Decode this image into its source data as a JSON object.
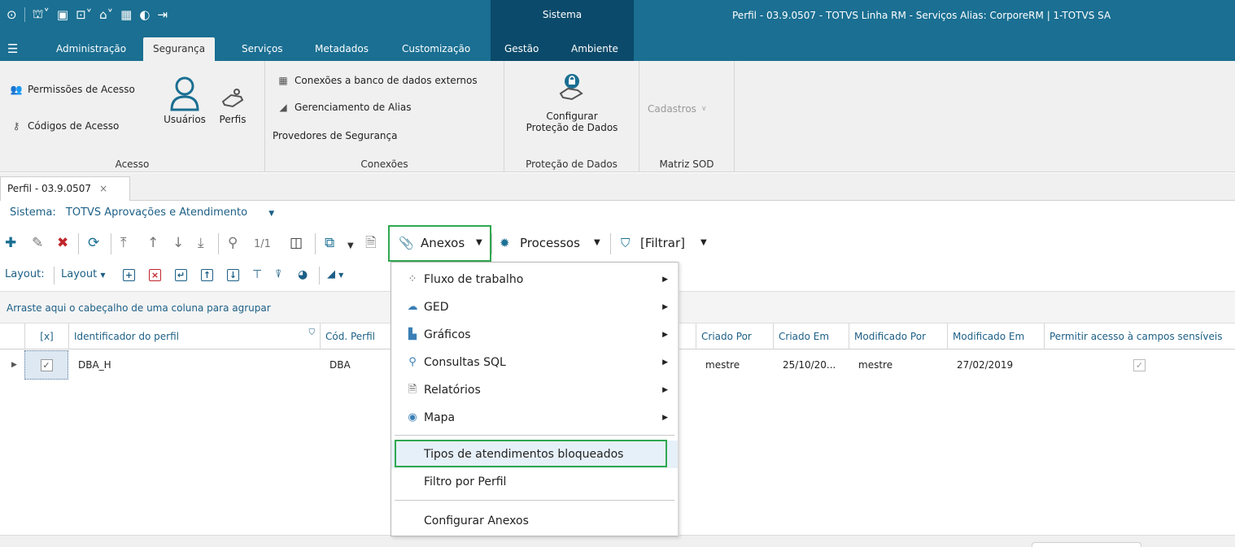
{
  "window": {
    "system_label": "Sistema",
    "title": "Perfil - 03.9.0507 - TOTVS Linha RM - Serviços  Alias: CorporeRM | 1-TOTVS SA"
  },
  "quick_access": [
    "system-menu-icon",
    "org-icon",
    "window-icon",
    "screen-icon",
    "home-icon",
    "calc-icon",
    "globe-icon",
    "exit-icon"
  ],
  "tabs": [
    {
      "label": "Administração"
    },
    {
      "label": "Segurança"
    },
    {
      "label": "Serviços"
    },
    {
      "label": "Metadados"
    },
    {
      "label": "Customização"
    },
    {
      "label": "Gestão"
    },
    {
      "label": "Ambiente"
    }
  ],
  "ribbon": {
    "acesso": {
      "permissoes": "Permissões de Acesso",
      "codigos": "Códigos de Acesso",
      "usuarios": "Usuários",
      "perfis": "Perfis",
      "label": "Acesso"
    },
    "conexoes": {
      "externos": "Conexões a banco de dados externos",
      "alias": "Gerenciamento de Alias",
      "provedores": "Provedores de Segurança",
      "label": "Conexões"
    },
    "protecao": {
      "configurar_line1": "Configurar",
      "configurar_line2": "Proteção de Dados",
      "label": "Proteção de Dados"
    },
    "matriz": {
      "cadastros": "Cadastros",
      "label": "Matriz SOD"
    }
  },
  "doc_tab": {
    "label": "Perfil - 03.9.0507",
    "close": "×"
  },
  "sistema": {
    "label": "Sistema:",
    "value": "TOTVS Aprovações e Atendimento"
  },
  "toolbar": {
    "page_counter": "1/1",
    "anexos": "Anexos",
    "processos": "Processos",
    "filtrar": "[Filtrar]"
  },
  "layout_bar": {
    "label": "Layout:",
    "dropdown": "Layout"
  },
  "groupby_hint": "Arraste aqui o cabeçalho de uma coluna para agrupar",
  "grid": {
    "columns": [
      "[x]",
      "Identificador do perfil",
      "Cód. Perfil",
      "Criado Por",
      "Criado Em",
      "Modificado Por",
      "Modificado Em",
      "Permitir acesso à campos sensíveis"
    ],
    "rows": [
      {
        "checked": true,
        "identificador": "DBA_H",
        "cod": "DBA",
        "criado_por": "mestre",
        "criado_em": "25/10/20...",
        "modificado_por": "mestre",
        "modificado_em": "27/02/2019",
        "campos_sensiveis": true
      }
    ]
  },
  "menu": {
    "items": [
      {
        "label": "Fluxo de trabalho",
        "icon": "workflow-icon",
        "submenu": true
      },
      {
        "label": "GED",
        "icon": "ged-icon",
        "submenu": true
      },
      {
        "label": "Gráficos",
        "icon": "chart-icon",
        "submenu": true
      },
      {
        "label": "Consultas SQL",
        "icon": "search-icon",
        "submenu": true
      },
      {
        "label": "Relatórios",
        "icon": "report-icon",
        "submenu": true
      },
      {
        "label": "Mapa",
        "icon": "map-pin-icon",
        "submenu": true
      }
    ],
    "blocked": "Tipos de atendimentos bloqueados",
    "filtro": "Filtro por Perfil",
    "configurar": "Configurar Anexos"
  },
  "colors": {
    "titlebar": "#1a6f92",
    "titlebar_dark": "#0b4a6a",
    "accent_green": "#2fa84f",
    "link_blue": "#1c5f86"
  }
}
